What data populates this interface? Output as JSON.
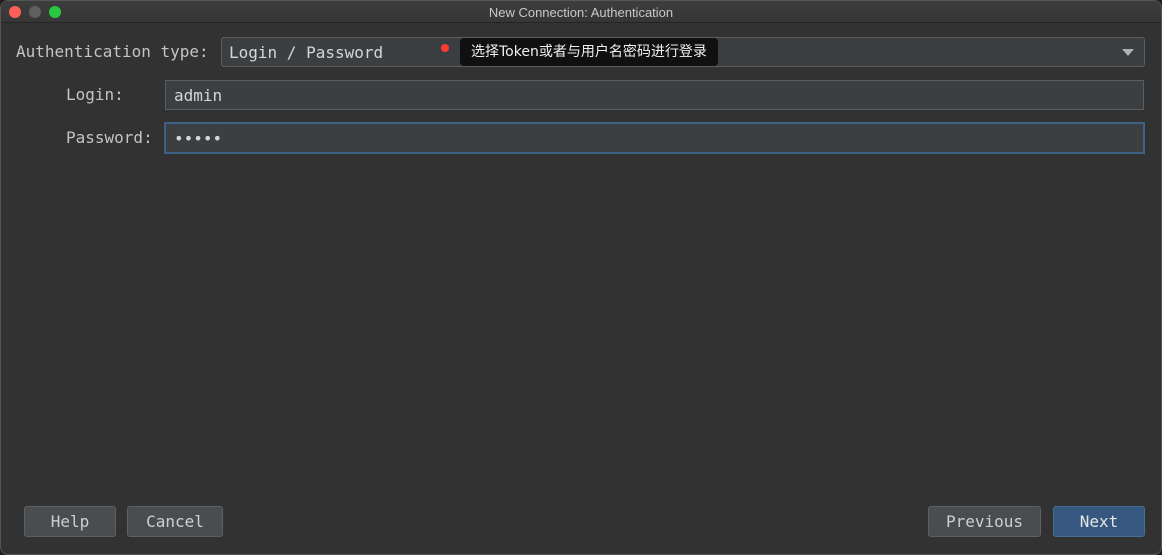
{
  "window": {
    "title": "New Connection: Authentication"
  },
  "form": {
    "auth_type_label": "Authentication type:",
    "auth_type_value": "Login / Password",
    "tooltip": "选择Token或者与用户名密码进行登录",
    "login_label": "Login:",
    "login_value": "admin",
    "password_label": "Password:",
    "password_value": "•••••"
  },
  "buttons": {
    "help": "Help",
    "cancel": "Cancel",
    "previous": "Previous",
    "next": "Next"
  },
  "colors": {
    "accent": "#365880",
    "focus_border": "#3d6185",
    "annotation_dot": "#ff3b30"
  }
}
